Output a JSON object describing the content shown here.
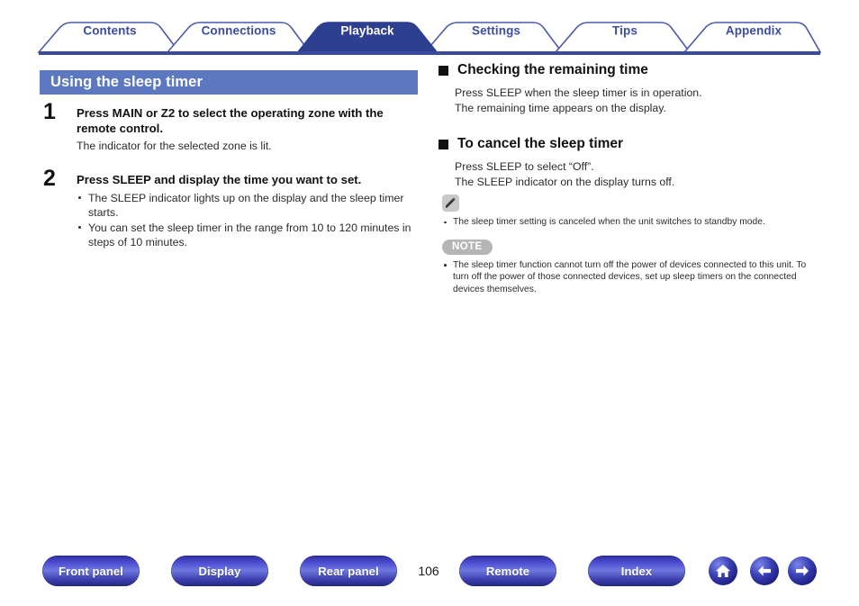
{
  "tabs": [
    {
      "label": "Contents",
      "active": false
    },
    {
      "label": "Connections",
      "active": false
    },
    {
      "label": "Playback",
      "active": true
    },
    {
      "label": "Settings",
      "active": false
    },
    {
      "label": "Tips",
      "active": false
    },
    {
      "label": "Appendix",
      "active": false
    }
  ],
  "page": {
    "title": "Using the sleep timer",
    "number": "106"
  },
  "steps": [
    {
      "number": "1",
      "heading": "Press MAIN or Z2 to select the operating zone with the remote control.",
      "sub": "The indicator for the selected zone is lit.",
      "bullets": []
    },
    {
      "number": "2",
      "heading": "Press SLEEP and display the time you want to set.",
      "sub": "",
      "bullets": [
        "The SLEEP indicator lights up on the display and the sleep timer starts.",
        "You can set the sleep timer in the range from 10 to 120 minutes in steps of 10 minutes."
      ]
    }
  ],
  "sections": [
    {
      "heading": "Checking the remaining time",
      "lines": [
        "Press SLEEP when the sleep timer is in operation.",
        "The remaining time appears on the display."
      ]
    },
    {
      "heading": "To cancel the sleep timer",
      "lines": [
        "Press SLEEP to select “Off”.",
        "The SLEEP indicator on the display turns off."
      ]
    }
  ],
  "tip": {
    "icon": "pencil-icon",
    "bullets": [
      "The sleep timer setting is canceled when the unit switches to standby mode."
    ]
  },
  "note": {
    "badge": "NOTE",
    "bullets": [
      "The sleep timer function cannot turn off the power of devices connected to this unit. To turn off the power of those connected devices, set up sleep timers on the connected devices themselves."
    ]
  },
  "footer": {
    "buttons": [
      {
        "label": "Front panel"
      },
      {
        "label": "Display"
      },
      {
        "label": "Rear panel"
      },
      {
        "label": "Remote"
      },
      {
        "label": "Index"
      }
    ],
    "icons": [
      {
        "name": "home-icon"
      },
      {
        "name": "arrow-left-icon"
      },
      {
        "name": "arrow-right-icon"
      }
    ]
  },
  "colors": {
    "tab_active_bg": "#2e3f8f",
    "tab_outline": "#4a59ad",
    "title_bar_bg": "#5c78c0",
    "tab_text": "#3b4da3",
    "badge_gray": "#b5b5b5",
    "button_blue": "#3a3fb4"
  }
}
